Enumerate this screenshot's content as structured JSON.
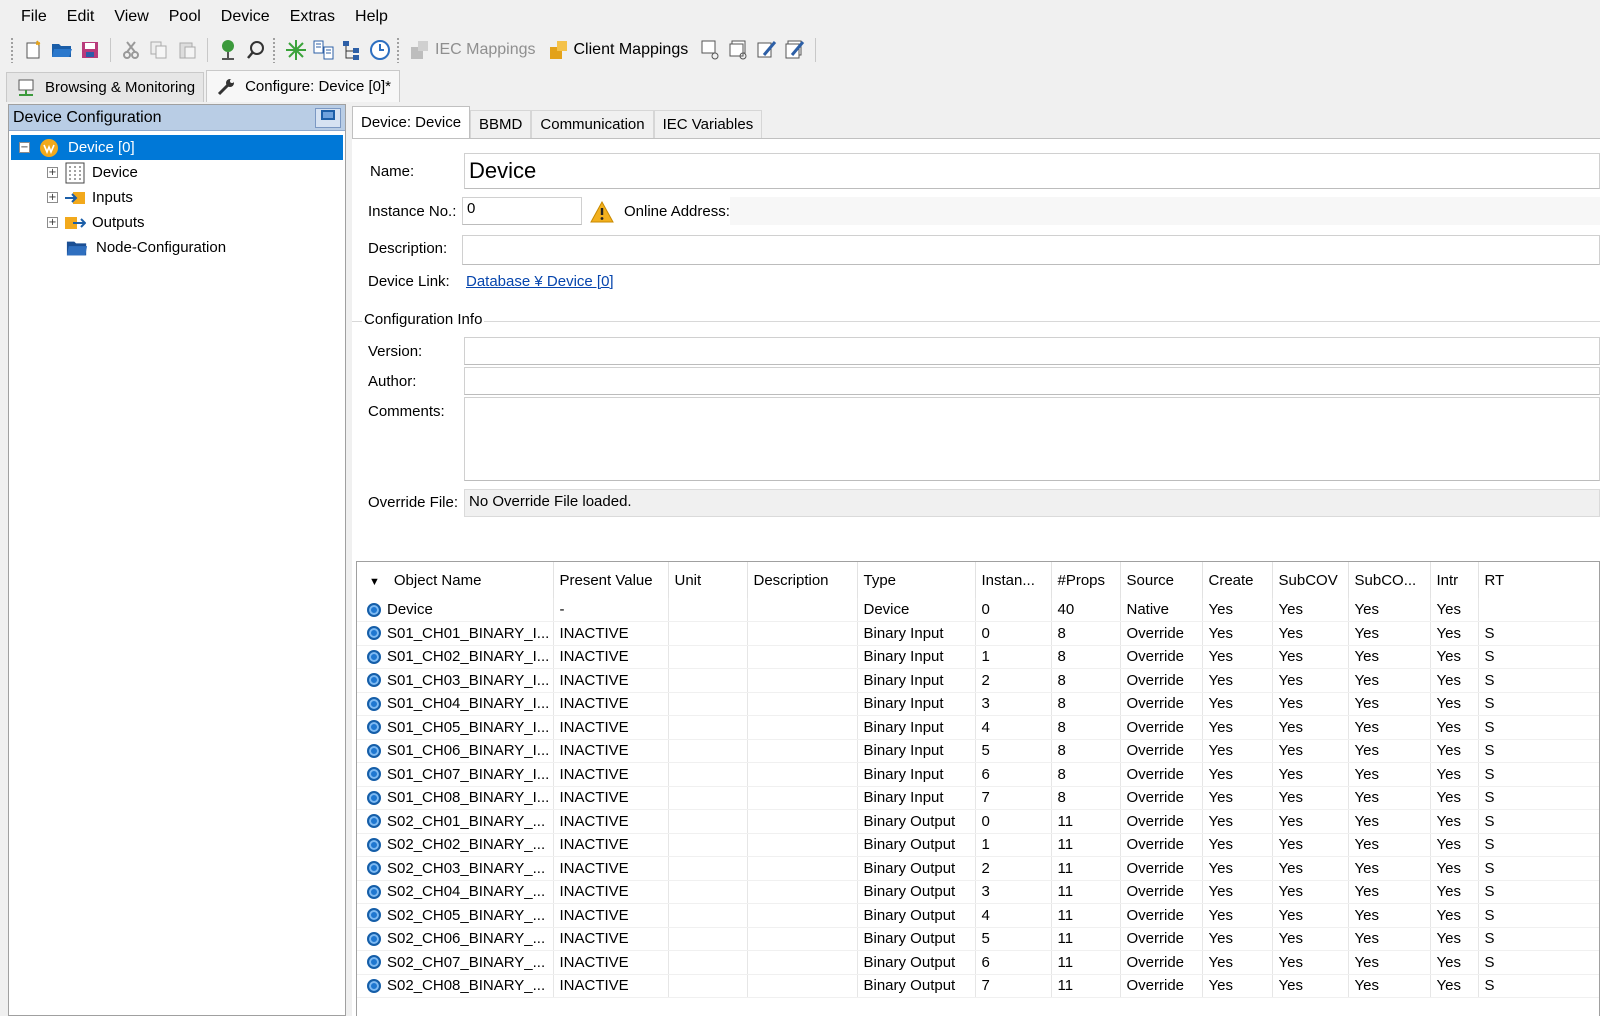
{
  "menu": [
    "File",
    "Edit",
    "View",
    "Pool",
    "Device",
    "Extras",
    "Help"
  ],
  "toolbar": {
    "iec_mappings_label": "IEC Mappings",
    "client_mappings_label": "Client Mappings"
  },
  "doc_tabs": [
    {
      "label": "Browsing & Monitoring"
    },
    {
      "label": "Configure: Device [0]*"
    }
  ],
  "left_panel": {
    "title": "Device Configuration",
    "tree": {
      "root": "Device [0]",
      "children": [
        "Device",
        "Inputs",
        "Outputs",
        "Node-Configuration"
      ]
    }
  },
  "prop_tabs": [
    "Device: Device",
    "BBMD",
    "Communication",
    "IEC Variables"
  ],
  "form": {
    "name_label": "Name:",
    "name_value": "Device",
    "instance_label": "Instance No.:",
    "instance_value": "0",
    "online_address_label": "Online Address:",
    "description_label": "Description:",
    "device_link_label": "Device Link:",
    "device_link_value": "Database ¥ Device [0]",
    "config_info_label": "Configuration Info",
    "version_label": "Version:",
    "author_label": "Author:",
    "comments_label": "Comments:",
    "override_label": "Override File:",
    "override_value": "No Override File loaded."
  },
  "grid": {
    "columns": [
      "Object Name",
      "Present Value",
      "Unit",
      "Description",
      "Type",
      "Instan...",
      "#Props",
      "Source",
      "Create",
      "SubCOV",
      "SubCO...",
      "Intr",
      "RT"
    ],
    "rows": [
      [
        "Device",
        "-",
        "",
        "",
        "Device",
        "0",
        "40",
        "Native",
        "Yes",
        "Yes",
        "Yes",
        "Yes",
        ""
      ],
      [
        "S01_CH01_BINARY_I...",
        "INACTIVE",
        "",
        "",
        "Binary Input",
        "0",
        "8",
        "Override",
        "Yes",
        "Yes",
        "Yes",
        "Yes",
        "S"
      ],
      [
        "S01_CH02_BINARY_I...",
        "INACTIVE",
        "",
        "",
        "Binary Input",
        "1",
        "8",
        "Override",
        "Yes",
        "Yes",
        "Yes",
        "Yes",
        "S"
      ],
      [
        "S01_CH03_BINARY_I...",
        "INACTIVE",
        "",
        "",
        "Binary Input",
        "2",
        "8",
        "Override",
        "Yes",
        "Yes",
        "Yes",
        "Yes",
        "S"
      ],
      [
        "S01_CH04_BINARY_I...",
        "INACTIVE",
        "",
        "",
        "Binary Input",
        "3",
        "8",
        "Override",
        "Yes",
        "Yes",
        "Yes",
        "Yes",
        "S"
      ],
      [
        "S01_CH05_BINARY_I...",
        "INACTIVE",
        "",
        "",
        "Binary Input",
        "4",
        "8",
        "Override",
        "Yes",
        "Yes",
        "Yes",
        "Yes",
        "S"
      ],
      [
        "S01_CH06_BINARY_I...",
        "INACTIVE",
        "",
        "",
        "Binary Input",
        "5",
        "8",
        "Override",
        "Yes",
        "Yes",
        "Yes",
        "Yes",
        "S"
      ],
      [
        "S01_CH07_BINARY_I...",
        "INACTIVE",
        "",
        "",
        "Binary Input",
        "6",
        "8",
        "Override",
        "Yes",
        "Yes",
        "Yes",
        "Yes",
        "S"
      ],
      [
        "S01_CH08_BINARY_I...",
        "INACTIVE",
        "",
        "",
        "Binary Input",
        "7",
        "8",
        "Override",
        "Yes",
        "Yes",
        "Yes",
        "Yes",
        "S"
      ],
      [
        "S02_CH01_BINARY_...",
        "INACTIVE",
        "",
        "",
        "Binary Output",
        "0",
        "11",
        "Override",
        "Yes",
        "Yes",
        "Yes",
        "Yes",
        "S"
      ],
      [
        "S02_CH02_BINARY_...",
        "INACTIVE",
        "",
        "",
        "Binary Output",
        "1",
        "11",
        "Override",
        "Yes",
        "Yes",
        "Yes",
        "Yes",
        "S"
      ],
      [
        "S02_CH03_BINARY_...",
        "INACTIVE",
        "",
        "",
        "Binary Output",
        "2",
        "11",
        "Override",
        "Yes",
        "Yes",
        "Yes",
        "Yes",
        "S"
      ],
      [
        "S02_CH04_BINARY_...",
        "INACTIVE",
        "",
        "",
        "Binary Output",
        "3",
        "11",
        "Override",
        "Yes",
        "Yes",
        "Yes",
        "Yes",
        "S"
      ],
      [
        "S02_CH05_BINARY_...",
        "INACTIVE",
        "",
        "",
        "Binary Output",
        "4",
        "11",
        "Override",
        "Yes",
        "Yes",
        "Yes",
        "Yes",
        "S"
      ],
      [
        "S02_CH06_BINARY_...",
        "INACTIVE",
        "",
        "",
        "Binary Output",
        "5",
        "11",
        "Override",
        "Yes",
        "Yes",
        "Yes",
        "Yes",
        "S"
      ],
      [
        "S02_CH07_BINARY_...",
        "INACTIVE",
        "",
        "",
        "Binary Output",
        "6",
        "11",
        "Override",
        "Yes",
        "Yes",
        "Yes",
        "Yes",
        "S"
      ],
      [
        "S02_CH08_BINARY_...",
        "INACTIVE",
        "",
        "",
        "Binary Output",
        "7",
        "11",
        "Override",
        "Yes",
        "Yes",
        "Yes",
        "Yes",
        "S"
      ]
    ]
  },
  "colors": {
    "selection": "#0078d7",
    "panel_header": "#b9cde5",
    "object_icon": "#1f77d0",
    "link": "#0645ad",
    "warning": "#f2b01e"
  },
  "icons": [
    "new-icon",
    "open-folder-icon",
    "save-icon",
    "cut-icon",
    "copy-icon",
    "paste-icon",
    "network-icon",
    "search-icon",
    "discover-icon",
    "compare-icon",
    "hierarchy-icon",
    "clock-icon",
    "warning-icon",
    "pin-icon",
    "object-icon"
  ]
}
